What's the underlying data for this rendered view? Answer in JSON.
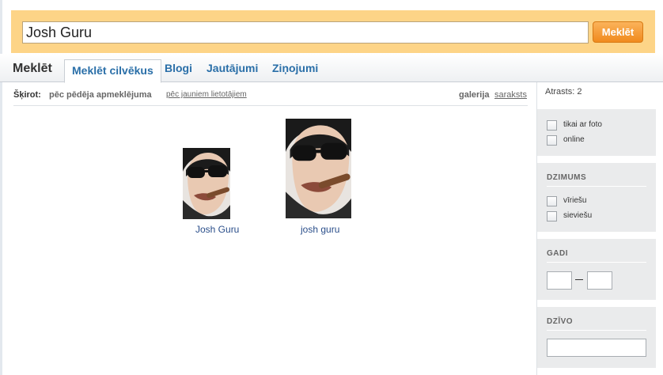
{
  "search": {
    "value": "Josh Guru",
    "button_label": "Meklēt"
  },
  "tabs": {
    "title": "Meklēt",
    "items": [
      {
        "label": "Meklēt cilvēkus",
        "active": true
      },
      {
        "label": "Blogi",
        "active": false
      },
      {
        "label": "Jautājumi",
        "active": false
      },
      {
        "label": "Ziņojumi",
        "active": false
      }
    ]
  },
  "sort": {
    "label": "Šķirot:",
    "options": [
      "pēc pēdēja apmeklējuma",
      "pēc jauniem lietotājiem"
    ],
    "views": [
      "galerija",
      "saraksts"
    ]
  },
  "results": [
    {
      "name": "Josh Guru"
    },
    {
      "name": "josh guru"
    }
  ],
  "sidebar": {
    "found": "Atrasts: 2",
    "filters": {
      "photo_label": "tikai ar foto",
      "online_label": "online"
    },
    "gender": {
      "title": "DZIMUMS",
      "male_label": "vīriešu",
      "female_label": "sieviešu"
    },
    "age": {
      "title": "GADI",
      "from": "",
      "to": ""
    },
    "city": {
      "title": "DZĪVO",
      "value": ""
    }
  },
  "colors": {
    "banner": "#fdd487",
    "button": "#f08a1e",
    "link": "#2a6fa8",
    "panel": "#eaebec"
  }
}
